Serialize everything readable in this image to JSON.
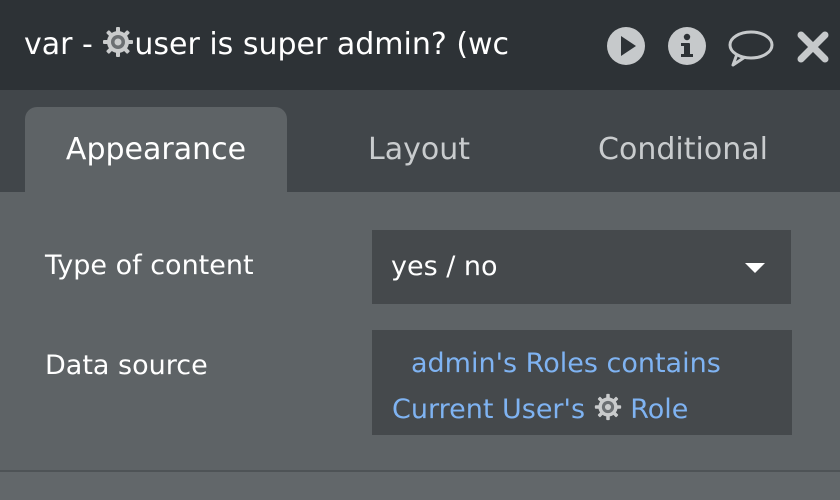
{
  "title_bar": {
    "prefix": "var - ",
    "name": "user is super admin? (wc",
    "icons": [
      "play-icon",
      "info-icon",
      "comment-icon",
      "close-icon"
    ]
  },
  "tabs": [
    {
      "label": "Appearance",
      "active": true
    },
    {
      "label": "Layout",
      "active": false
    },
    {
      "label": "Conditional",
      "active": false
    }
  ],
  "fields": {
    "type_of_content": {
      "label": "Type of content",
      "value": "yes / no"
    },
    "data_source": {
      "label": "Data source",
      "line1": "admin's Roles contains",
      "line2_prefix": "Current User's ",
      "line2_suffix": " Role"
    }
  },
  "colors": {
    "titlebar_bg": "#2d3236",
    "tabs_bg": "#41464a",
    "panel_bg": "#5e6366",
    "field_bg": "#45494c",
    "expression_text": "#7fb3f2"
  }
}
